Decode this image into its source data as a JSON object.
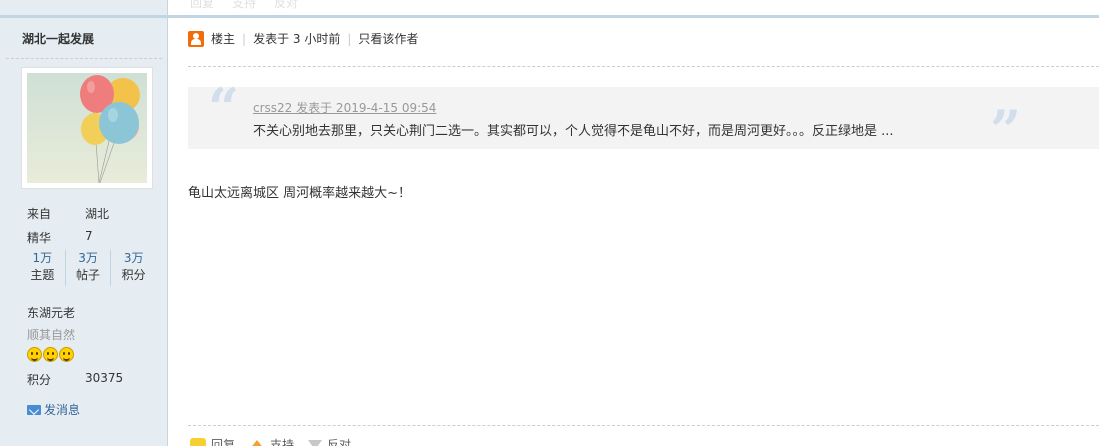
{
  "sidebar": {
    "username": "湖北一起发展",
    "from_label": "来自",
    "from_value": "湖北",
    "digest_label": "精华",
    "digest_value": "7",
    "stats": [
      {
        "num": "1万",
        "label": "主题"
      },
      {
        "num": "3万",
        "label": "帖子"
      },
      {
        "num": "3万",
        "label": "积分"
      }
    ],
    "rank_title": "东湖元老",
    "rank_subtitle": "顺其自然",
    "points_label": "积分",
    "points_value": "30375",
    "send_message": "发消息"
  },
  "top_ghost": {
    "reply": "回复",
    "support": "支持",
    "oppose": "反对"
  },
  "post": {
    "author_tag": "楼主",
    "posted_time": "发表于 3 小时前",
    "only_author": "只看该作者",
    "quote": {
      "meta": "crss22 发表于 2019-4-15 09:54",
      "text": "不关心别地去那里，只关心荆门二选一。其实都可以，个人觉得不是龟山不好，而是周河更好。。。反正绿地是 ..."
    },
    "content": "龟山太远离城区  周河概率越来越大~！"
  },
  "actions": {
    "reply": "回复",
    "support": "支持",
    "oppose": "反对"
  },
  "colors": {
    "sidebar_bg": "#e5edf2",
    "border": "#c2d5e3",
    "link": "#336699",
    "quote_bg": "#f3f3f3"
  }
}
